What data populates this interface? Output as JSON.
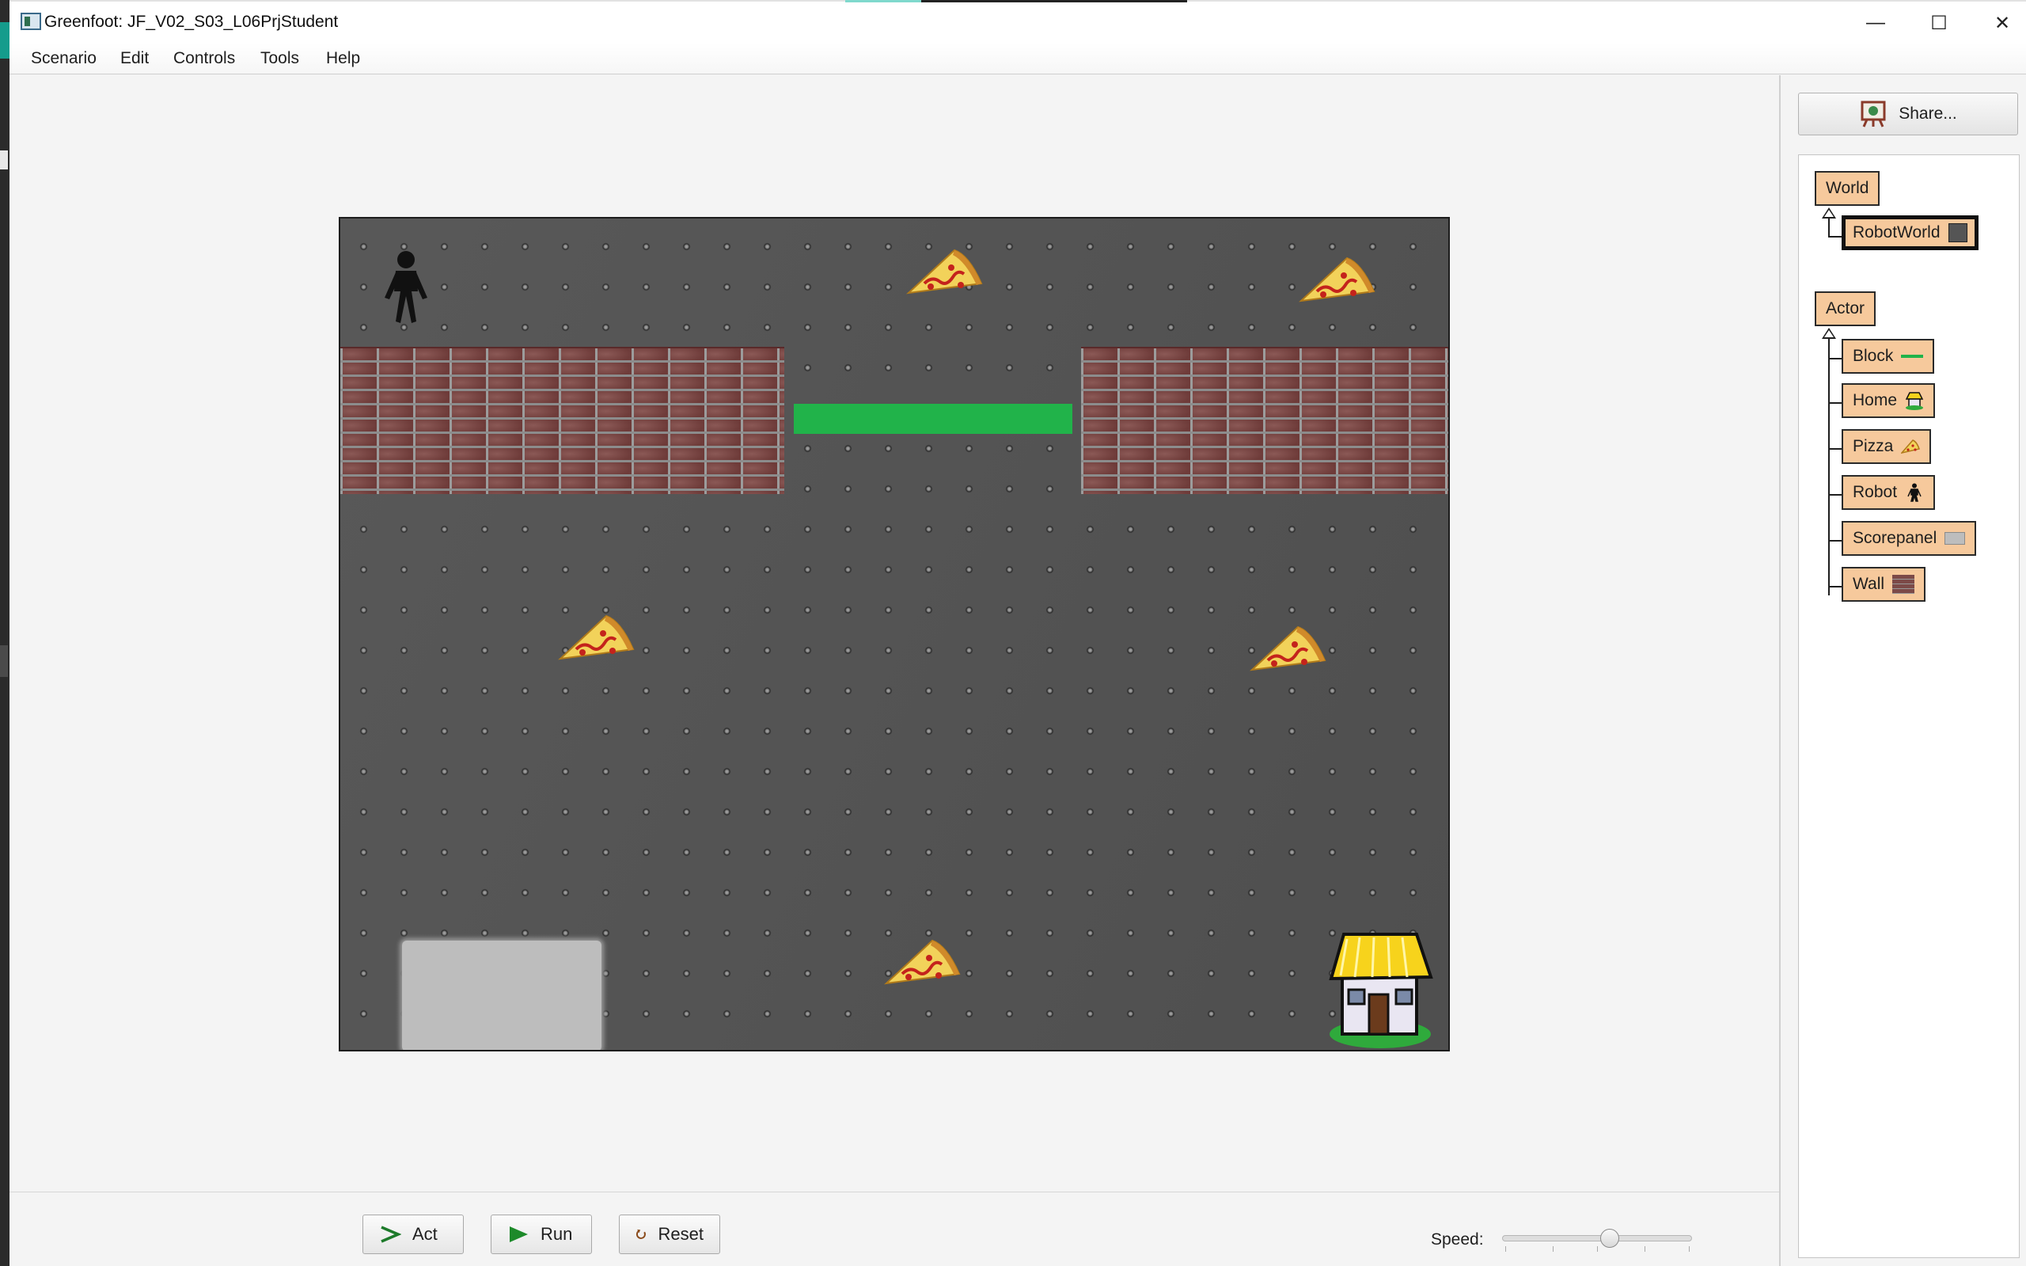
{
  "window": {
    "title": "Greenfoot:  JF_V02_S03_L06PrjStudent",
    "minimize_glyph": "—",
    "maximize_glyph": "☐",
    "close_glyph": "✕"
  },
  "menu": [
    "Scenario",
    "Edit",
    "Controls",
    "Tools",
    "Help"
  ],
  "controls": {
    "act_label": "Act",
    "run_label": "Run",
    "reset_label": "Reset",
    "speed_label": "Speed:",
    "speed_value": 0.5
  },
  "share": {
    "label": "Share..."
  },
  "classes": {
    "world_root": "World",
    "world_subclasses": [
      {
        "name": "RobotWorld",
        "selected": true
      }
    ],
    "actor_root": "Actor",
    "actor_subclasses": [
      {
        "name": "Block",
        "icon": "green-line-icon"
      },
      {
        "name": "Home",
        "icon": "house-icon"
      },
      {
        "name": "Pizza",
        "icon": "pizza-icon"
      },
      {
        "name": "Robot",
        "icon": "stick-figure-icon"
      },
      {
        "name": "Scorepanel",
        "icon": "gray-panel-icon"
      },
      {
        "name": "Wall",
        "icon": "brick-icon"
      }
    ]
  },
  "colors": {
    "block_green": "#21b34a",
    "class_fill": "#f6c99c",
    "world_background": "#535353"
  }
}
